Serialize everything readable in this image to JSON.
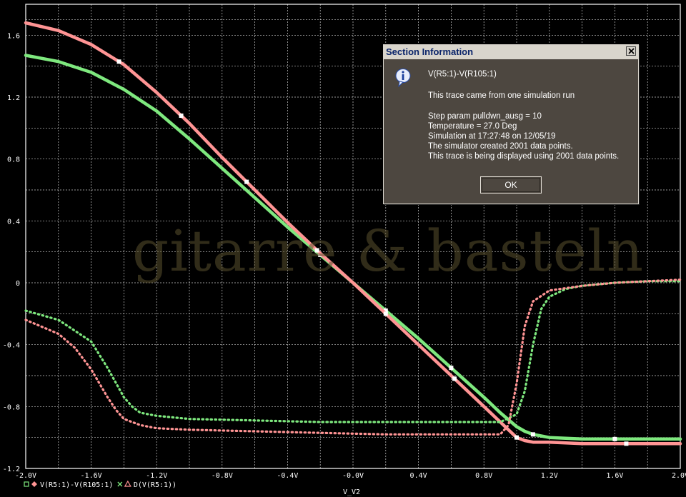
{
  "chart_data": {
    "type": "line",
    "xlabel": "V_V2",
    "xlim": [
      -2.0,
      2.0
    ],
    "ylim": [
      -1.2,
      1.8
    ],
    "x_ticks": [
      -2.0,
      -1.6,
      -1.2,
      -0.8,
      -0.4,
      0.0,
      0.4,
      0.8,
      1.2,
      1.6,
      2.0
    ],
    "x_tick_labels": [
      "-2.0V",
      "-1.6V",
      "-1.2V",
      "-0.8V",
      "-0.4V",
      "-0.0V",
      "0.4V",
      "0.8V",
      "1.2V",
      "1.6V",
      "2.0V"
    ],
    "y_ticks": [
      1.6,
      1.2,
      0.8,
      0.4,
      0,
      -0.4,
      -0.8,
      -1.2
    ],
    "y_tick_labels": [
      "1.6",
      "1.2",
      "0.8",
      "0.4",
      "0",
      "-0.4",
      "-0.8",
      "-1.2"
    ],
    "grid": true,
    "series": [
      {
        "name": "V(R5:1)-V(R105:1)",
        "legend_marker": "square",
        "style": "solid",
        "color": "#7ee87e",
        "x": [
          -2.0,
          -1.8,
          -1.6,
          -1.4,
          -1.2,
          -1.0,
          -0.8,
          -0.6,
          -0.4,
          -0.2,
          0.0,
          0.2,
          0.4,
          0.6,
          0.8,
          0.9,
          1.0,
          1.05,
          1.1,
          1.2,
          1.4,
          1.6,
          1.8,
          2.0
        ],
        "y": [
          1.47,
          1.43,
          1.36,
          1.25,
          1.11,
          0.93,
          0.74,
          0.55,
          0.36,
          0.18,
          0.0,
          -0.18,
          -0.36,
          -0.55,
          -0.74,
          -0.84,
          -0.93,
          -0.96,
          -0.98,
          -1.0,
          -1.01,
          -1.01,
          -1.01,
          -1.01
        ]
      },
      {
        "name": "V(R5:1)-V(R105:1)",
        "legend_marker": "diamond",
        "style": "solid",
        "color": "#ff9494",
        "x": [
          -2.0,
          -1.8,
          -1.6,
          -1.4,
          -1.2,
          -1.0,
          -0.8,
          -0.6,
          -0.4,
          -0.2,
          0.0,
          0.2,
          0.4,
          0.6,
          0.8,
          0.9,
          1.0,
          1.05,
          1.1,
          1.2,
          1.4,
          1.6,
          1.8,
          2.0
        ],
        "y": [
          1.68,
          1.63,
          1.54,
          1.41,
          1.23,
          1.03,
          0.81,
          0.6,
          0.39,
          0.19,
          0.0,
          -0.2,
          -0.4,
          -0.6,
          -0.8,
          -0.9,
          -1.0,
          -1.02,
          -1.03,
          -1.03,
          -1.04,
          -1.04,
          -1.04,
          -1.04
        ]
      },
      {
        "name": "D(V(R5:1))",
        "legend_marker": "x",
        "style": "dotted",
        "color": "#7ee87e",
        "x": [
          -2.0,
          -1.8,
          -1.6,
          -1.5,
          -1.4,
          -1.35,
          -1.3,
          -1.2,
          -1.0,
          -0.6,
          -0.2,
          0.2,
          0.6,
          0.9,
          1.0,
          1.05,
          1.1,
          1.15,
          1.2,
          1.3,
          1.4,
          1.6,
          1.8,
          2.0
        ],
        "y": [
          -0.18,
          -0.24,
          -0.38,
          -0.55,
          -0.74,
          -0.8,
          -0.84,
          -0.86,
          -0.88,
          -0.89,
          -0.9,
          -0.9,
          -0.9,
          -0.9,
          -0.85,
          -0.7,
          -0.4,
          -0.17,
          -0.09,
          -0.04,
          -0.02,
          0.0,
          0.01,
          0.01
        ]
      },
      {
        "name": "D(V(R5:1))",
        "legend_marker": "triangle",
        "style": "dotted",
        "color": "#ff9494",
        "x": [
          -2.0,
          -1.8,
          -1.7,
          -1.6,
          -1.5,
          -1.45,
          -1.4,
          -1.3,
          -1.2,
          -1.0,
          -0.6,
          -0.2,
          0.2,
          0.6,
          0.9,
          0.95,
          1.0,
          1.05,
          1.1,
          1.2,
          1.4,
          1.6,
          1.8,
          2.0
        ],
        "y": [
          -0.24,
          -0.33,
          -0.42,
          -0.56,
          -0.74,
          -0.82,
          -0.88,
          -0.92,
          -0.94,
          -0.95,
          -0.96,
          -0.97,
          -0.98,
          -0.98,
          -0.98,
          -0.92,
          -0.65,
          -0.28,
          -0.12,
          -0.05,
          -0.02,
          0.0,
          0.01,
          0.02
        ]
      }
    ]
  },
  "watermark": "gitarre & basteln",
  "dialog": {
    "title": "Section Information",
    "trace": "V(R5:1)-V(R105:1)",
    "source": "This trace came from one simulation run",
    "step_param": "Step param pulldwn_ausg =    10",
    "temperature": "Temperature =  27.0 Deg",
    "sim_time": "Simulation at 17:27:48 on 12/05/19",
    "points_created": "The simulator created 2001 data points.",
    "points_displayed": "This trace is being displayed using 2001 data points.",
    "ok_label": "OK"
  },
  "icons": {
    "close": "close-icon",
    "info": "info-icon"
  },
  "colors": {
    "background": "#000000",
    "grid": "#ffffff",
    "green": "#7ee87e",
    "red": "#ff9494"
  }
}
